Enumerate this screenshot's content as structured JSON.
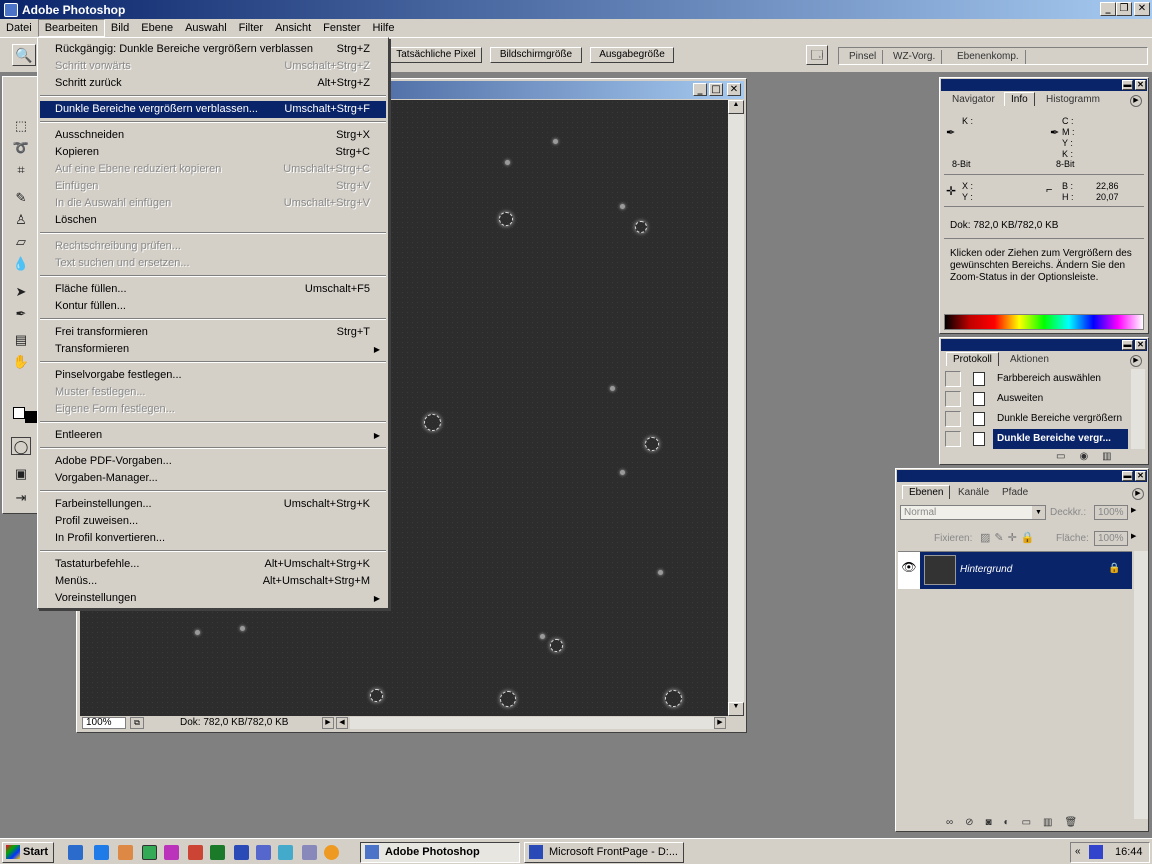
{
  "window": {
    "title": "Adobe Photoshop"
  },
  "menubar": [
    "Datei",
    "Bearbeiten",
    "Bild",
    "Ebene",
    "Auswahl",
    "Filter",
    "Ansicht",
    "Fenster",
    "Hilfe"
  ],
  "options": {
    "buttons": [
      "Tatsächliche Pixel",
      "Bildschirmgröße",
      "Ausgabegröße"
    ],
    "well_tabs": [
      "Pinsel",
      "WZ-Vorg.",
      "Ebenenkomp."
    ]
  },
  "edit_menu": {
    "items": [
      {
        "label": "Rückgängig: Dunkle Bereiche vergrößern verblassen",
        "shortcut": "Strg+Z",
        "state": "enabled"
      },
      {
        "label": "Schritt vorwärts",
        "shortcut": "Umschalt+Strg+Z",
        "state": "disabled"
      },
      {
        "label": "Schritt zurück",
        "shortcut": "Alt+Strg+Z",
        "state": "enabled"
      },
      {
        "label": "Dunkle Bereiche vergrößern verblassen...",
        "shortcut": "Umschalt+Strg+F",
        "state": "highlighted"
      },
      {
        "label": "Ausschneiden",
        "shortcut": "Strg+X",
        "state": "enabled"
      },
      {
        "label": "Kopieren",
        "shortcut": "Strg+C",
        "state": "enabled"
      },
      {
        "label": "Auf eine Ebene reduziert kopieren",
        "shortcut": "Umschalt+Strg+C",
        "state": "disabled"
      },
      {
        "label": "Einfügen",
        "shortcut": "Strg+V",
        "state": "disabled"
      },
      {
        "label": "In die Auswahl einfügen",
        "shortcut": "Umschalt+Strg+V",
        "state": "disabled"
      },
      {
        "label": "Löschen",
        "shortcut": "",
        "state": "enabled"
      },
      {
        "label": "Rechtschreibung prüfen...",
        "shortcut": "",
        "state": "disabled"
      },
      {
        "label": "Text suchen und ersetzen...",
        "shortcut": "",
        "state": "disabled"
      },
      {
        "label": "Fläche füllen...",
        "shortcut": "Umschalt+F5",
        "state": "enabled"
      },
      {
        "label": "Kontur füllen...",
        "shortcut": "",
        "state": "enabled"
      },
      {
        "label": "Frei transformieren",
        "shortcut": "Strg+T",
        "state": "enabled"
      },
      {
        "label": "Transformieren",
        "shortcut": "",
        "state": "submenu"
      },
      {
        "label": "Pinselvorgabe festlegen...",
        "shortcut": "",
        "state": "enabled"
      },
      {
        "label": "Muster festlegen...",
        "shortcut": "",
        "state": "disabled"
      },
      {
        "label": "Eigene Form festlegen...",
        "shortcut": "",
        "state": "disabled"
      },
      {
        "label": "Entleeren",
        "shortcut": "",
        "state": "submenu"
      },
      {
        "label": "Adobe PDF-Vorgaben...",
        "shortcut": "",
        "state": "enabled"
      },
      {
        "label": "Vorgaben-Manager...",
        "shortcut": "",
        "state": "enabled"
      },
      {
        "label": "Farbeinstellungen...",
        "shortcut": "Umschalt+Strg+K",
        "state": "enabled"
      },
      {
        "label": "Profil zuweisen...",
        "shortcut": "",
        "state": "enabled"
      },
      {
        "label": "In Profil konvertieren...",
        "shortcut": "",
        "state": "enabled"
      },
      {
        "label": "Tastaturbefehle...",
        "shortcut": "Alt+Umschalt+Strg+K",
        "state": "enabled"
      },
      {
        "label": "Menüs...",
        "shortcut": "Alt+Umschalt+Strg+M",
        "state": "enabled"
      },
      {
        "label": "Voreinstellungen",
        "shortcut": "",
        "state": "submenu"
      }
    ]
  },
  "document": {
    "zoom": "100%",
    "status": "Dok: 782,0 KB/782,0 KB"
  },
  "info_panel": {
    "tabs": [
      "Navigator",
      "Info",
      "Histogramm"
    ],
    "k_label": "K :",
    "cmyk": [
      "C :",
      "M :",
      "Y :",
      "K :"
    ],
    "bit_left": "8-Bit",
    "bit_right": "8-Bit",
    "x_label": "X :",
    "y_label": "Y :",
    "b_label": "B :",
    "h_label": "H :",
    "b_value": "22,86",
    "h_value": "20,07",
    "doc": "Dok: 782,0 KB/782,0 KB",
    "hint": "Klicken oder Ziehen zum Vergrößern des gewünschten Bereichs. Ändern Sie den Zoom-Status in der Optionsleiste."
  },
  "history_panel": {
    "tabs": [
      "Protokoll",
      "Aktionen"
    ],
    "items": [
      "Farbbereich auswählen",
      "Ausweiten",
      "Dunkle Bereiche vergrößern",
      "Dunkle Bereiche vergr..."
    ]
  },
  "layers_panel": {
    "tabs": [
      "Ebenen",
      "Kanäle",
      "Pfade"
    ],
    "blend_mode": "Normal",
    "opacity_label": "Deckkr.:",
    "opacity": "100%",
    "lock_label": "Fixieren:",
    "fill_label": "Fläche:",
    "fill": "100%",
    "layer_name": "Hintergrund"
  },
  "taskbar": {
    "start": "Start",
    "tasks": [
      "Adobe Photoshop",
      "Microsoft FrontPage - D:..."
    ],
    "clock": "16:44"
  }
}
